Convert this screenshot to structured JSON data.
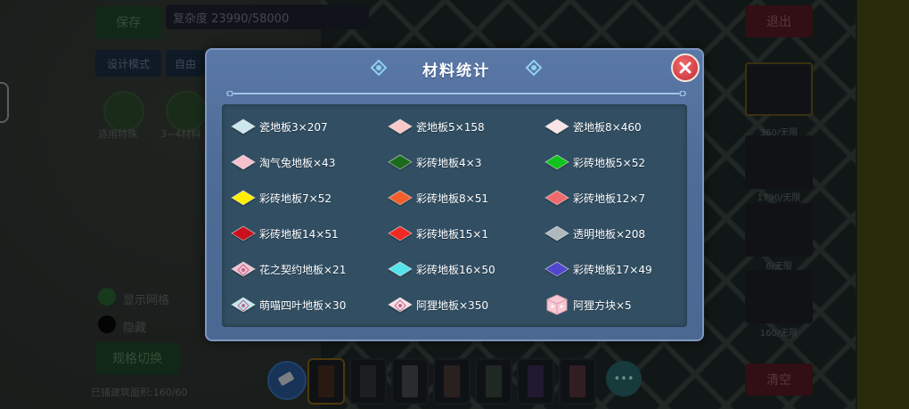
{
  "background": {
    "top_left_button": "保存",
    "complexity_label": "复杂度 23990/58000",
    "exit_button": "退出",
    "design_mode_button": "设计模式",
    "free_button": "自由",
    "circle_label_1": "适用特殊",
    "circle_label_2": "3~4材料",
    "check_label_1": "显示网格",
    "check_label_2": "隐藏",
    "switch_button": "规格切换",
    "bottom_text": "已铺建筑面积:160/60",
    "side_labels": [
      "360/无限",
      "1790/无限",
      "6/无限",
      "160/无限"
    ],
    "clear_button": "清空",
    "more_button": "•••"
  },
  "modal": {
    "title": "材料统计",
    "items": [
      {
        "label": "瓷地板3×207",
        "color": "#cde6ee",
        "kind": "tile"
      },
      {
        "label": "瓷地板5×158",
        "color": "#f7c9c9",
        "kind": "tile"
      },
      {
        "label": "瓷地板8×460",
        "color": "#fbe4e6",
        "kind": "tile"
      },
      {
        "label": "淘气兔地板×43",
        "color": "#f7c0cd",
        "kind": "tile"
      },
      {
        "label": "彩砖地板4×3",
        "color": "#1c6b1c",
        "kind": "tile"
      },
      {
        "label": "彩砖地板5×52",
        "color": "#10c21b",
        "kind": "tile"
      },
      {
        "label": "彩砖地板7×52",
        "color": "#ffee00",
        "kind": "tile"
      },
      {
        "label": "彩砖地板8×51",
        "color": "#f2602b",
        "kind": "tile"
      },
      {
        "label": "彩砖地板12×7",
        "color": "#ef6a6c",
        "kind": "tile"
      },
      {
        "label": "彩砖地板14×51",
        "color": "#c9101c",
        "kind": "tile"
      },
      {
        "label": "彩砖地板15×1",
        "color": "#ef2a24",
        "kind": "tile"
      },
      {
        "label": "透明地板×208",
        "color": "#aeb8be",
        "kind": "tile"
      },
      {
        "label": "花之契约地板×21",
        "color": "#f1c3d3",
        "kind": "patterned"
      },
      {
        "label": "彩砖地板16×50",
        "color": "#55e3ec",
        "kind": "tile"
      },
      {
        "label": "彩砖地板17×49",
        "color": "#5046cf",
        "kind": "tile"
      },
      {
        "label": "萌喵四叶地板×30",
        "color": "#bfeaf0",
        "kind": "patterned"
      },
      {
        "label": "阿狸地板×350",
        "color": "#fbe0e6",
        "kind": "patterned"
      },
      {
        "label": "阿狸方块×5",
        "color": "#f6c9d4",
        "kind": "cube"
      }
    ]
  }
}
